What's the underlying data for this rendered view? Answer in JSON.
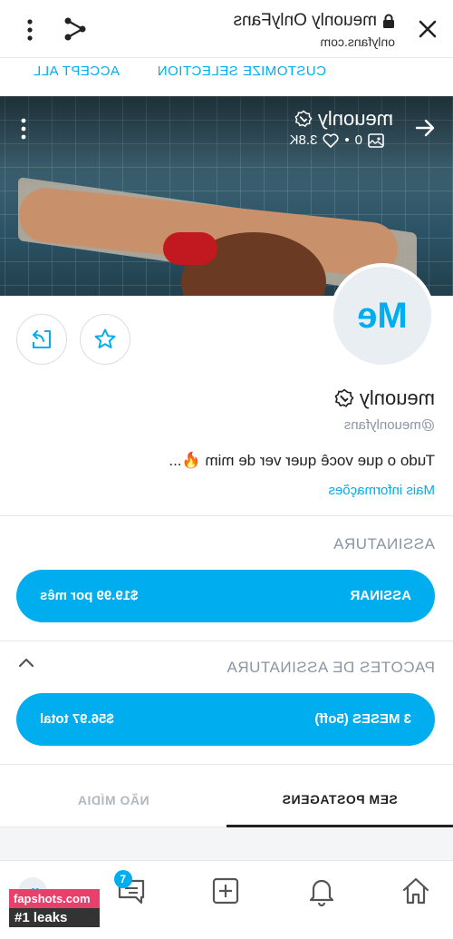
{
  "browser": {
    "title": "meuonly OnlyFans",
    "url": "onlyfans.com",
    "icons": [
      "close-icon",
      "lock-icon",
      "share-icon",
      "more-vertical-icon"
    ]
  },
  "cookie_bar": {
    "customize": "CUSTOMIZE SELECTION",
    "accept": "ACCEPT ALL"
  },
  "cover": {
    "name": "meuonly",
    "photos": "0",
    "likes": "3.8K",
    "dot": "•"
  },
  "profile": {
    "avatar_initials": "Me",
    "name": "meuonly",
    "handle": "@meuonlyfans",
    "bio": "Tudo o que você quer ver de mim 🔥...",
    "more_info": "Mais informações"
  },
  "subscription": {
    "section_title": "ASSINATURA",
    "button_label": "ASSINAR",
    "price": "$19.99 por mês"
  },
  "bundles": {
    "section_title": "PACOTES DE ASSINATURA",
    "button_label": "3 MESES (5off)",
    "price": "$56.97 total"
  },
  "tabs": {
    "posts": "SEM POSTAGENS",
    "media": "NÃO MÍDIA"
  },
  "bottom_nav": {
    "messages_badge": "7",
    "avatar_initials": "Me"
  },
  "watermark": {
    "line1": "fapshots.com",
    "line2": "#1 leaks"
  },
  "colors": {
    "accent": "#00aeef",
    "muted": "#8a96a3"
  }
}
